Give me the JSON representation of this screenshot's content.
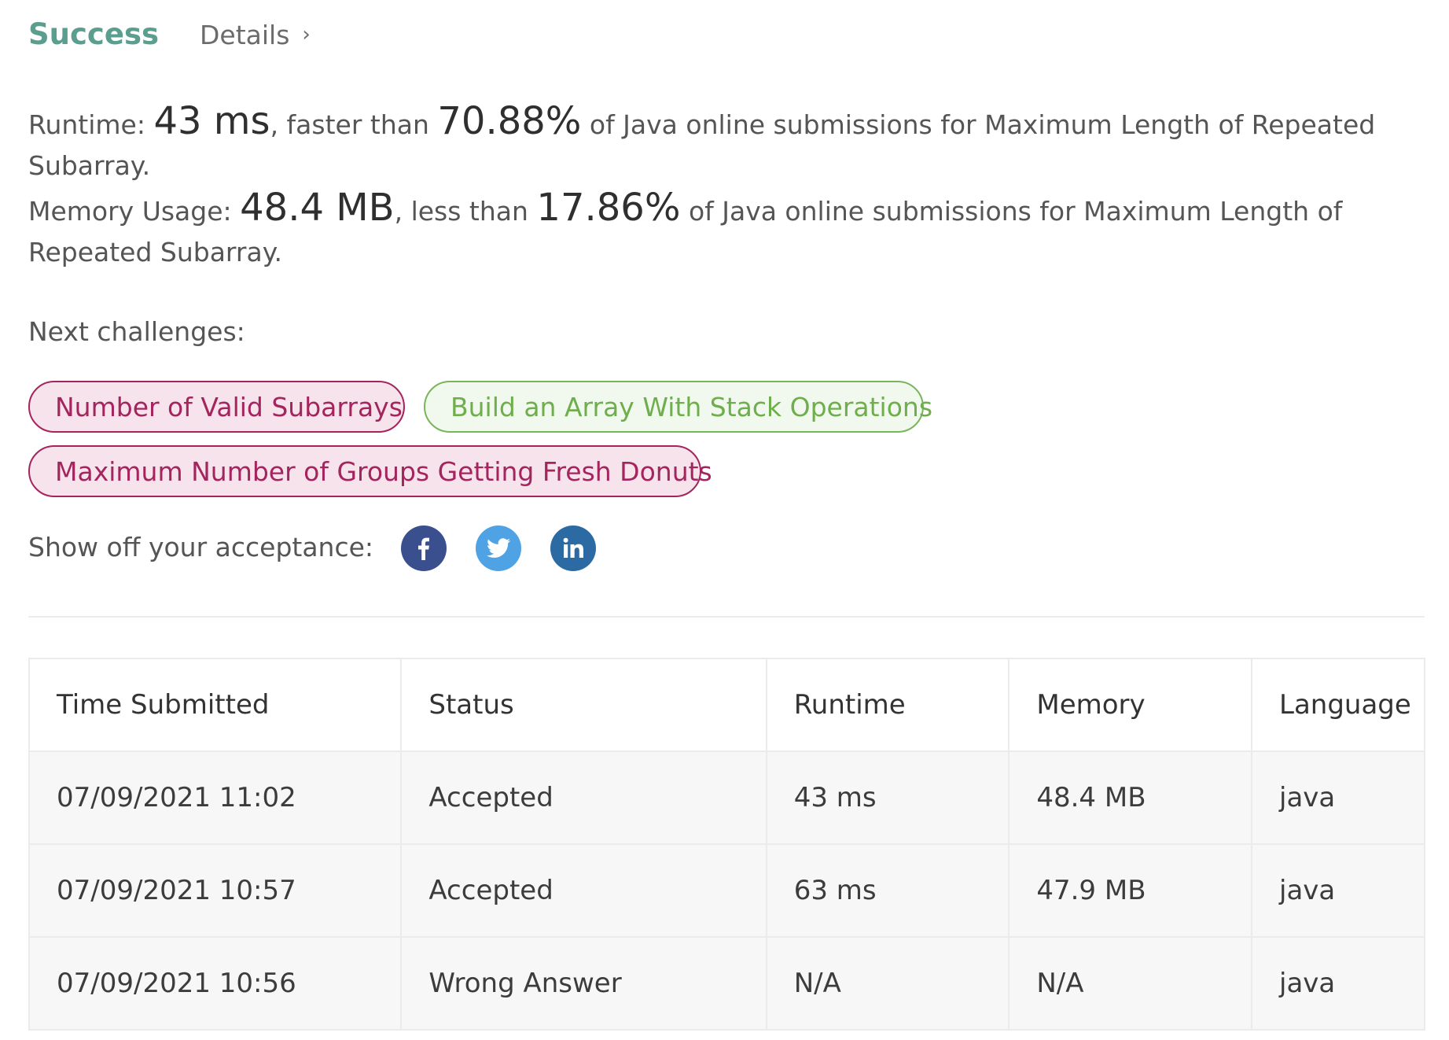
{
  "header": {
    "status": "Success",
    "details_label": "Details",
    "chevron": "›"
  },
  "runtime": {
    "label": "Runtime: ",
    "value": "43 ms",
    "comparison": ", faster than ",
    "percent": "70.88%",
    "suffix": " of Java online submissions for Maximum Length of Repeated Subarray."
  },
  "memory": {
    "label": "Memory Usage: ",
    "value": "48.4 MB",
    "comparison": ", less than ",
    "percent": "17.86%",
    "suffix": " of Java online submissions for Maximum Length of Repeated Subarray."
  },
  "next_challenges": {
    "label": "Next challenges:",
    "items": [
      {
        "label": "Number of Valid Subarrays",
        "difficulty": "hard"
      },
      {
        "label": "Build an Array With Stack Operations",
        "difficulty": "easy"
      },
      {
        "label": "Maximum Number of Groups Getting Fresh Donuts",
        "difficulty": "hard"
      }
    ]
  },
  "share": {
    "label": "Show off your acceptance:",
    "icons": [
      "facebook-icon",
      "twitter-icon",
      "linkedin-icon"
    ]
  },
  "submissions": {
    "columns": [
      "Time Submitted",
      "Status",
      "Runtime",
      "Memory",
      "Language"
    ],
    "rows": [
      {
        "time": "07/09/2021 11:02",
        "status": "Accepted",
        "runtime": "43 ms",
        "memory": "48.4 MB",
        "language": "java"
      },
      {
        "time": "07/09/2021 10:57",
        "status": "Accepted",
        "runtime": "63 ms",
        "memory": "47.9 MB",
        "language": "java"
      },
      {
        "time": "07/09/2021 10:56",
        "status": "Wrong Answer",
        "runtime": "N/A",
        "memory": "N/A",
        "language": "java"
      }
    ]
  },
  "colors": {
    "success": "#5a9e90",
    "accepted": "#4f9a85",
    "wrong_answer": "#b03b36",
    "hard_pill": "#a4245e",
    "easy_pill": "#7ab55a",
    "facebook": "#3a4f8e",
    "twitter": "#4fa3e4",
    "linkedin": "#2b6aa3"
  }
}
